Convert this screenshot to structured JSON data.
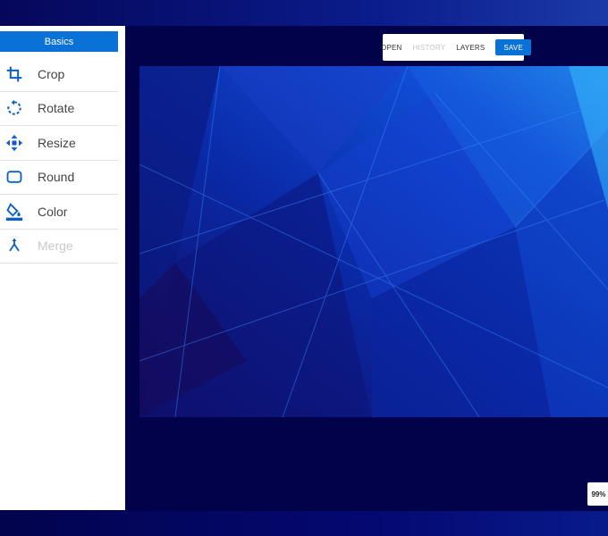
{
  "sidebar": {
    "header": "Basics",
    "items": [
      {
        "label": "Crop",
        "icon": "crop-icon",
        "enabled": true
      },
      {
        "label": "Rotate",
        "icon": "rotate-icon",
        "enabled": true
      },
      {
        "label": "Resize",
        "icon": "resize-icon",
        "enabled": true
      },
      {
        "label": "Round",
        "icon": "round-icon",
        "enabled": true
      },
      {
        "label": "Color",
        "icon": "paint-bucket-icon",
        "enabled": true
      },
      {
        "label": "Merge",
        "icon": "merge-icon",
        "enabled": false
      }
    ]
  },
  "toolbar": {
    "open": "OPEN",
    "history": "HISTORY",
    "layers": "LAYERS",
    "save": "SAVE"
  },
  "zoom": "99%",
  "colors": {
    "accent": "#0a72d6",
    "background": "#02034b",
    "icon": "#0b5fc4"
  }
}
